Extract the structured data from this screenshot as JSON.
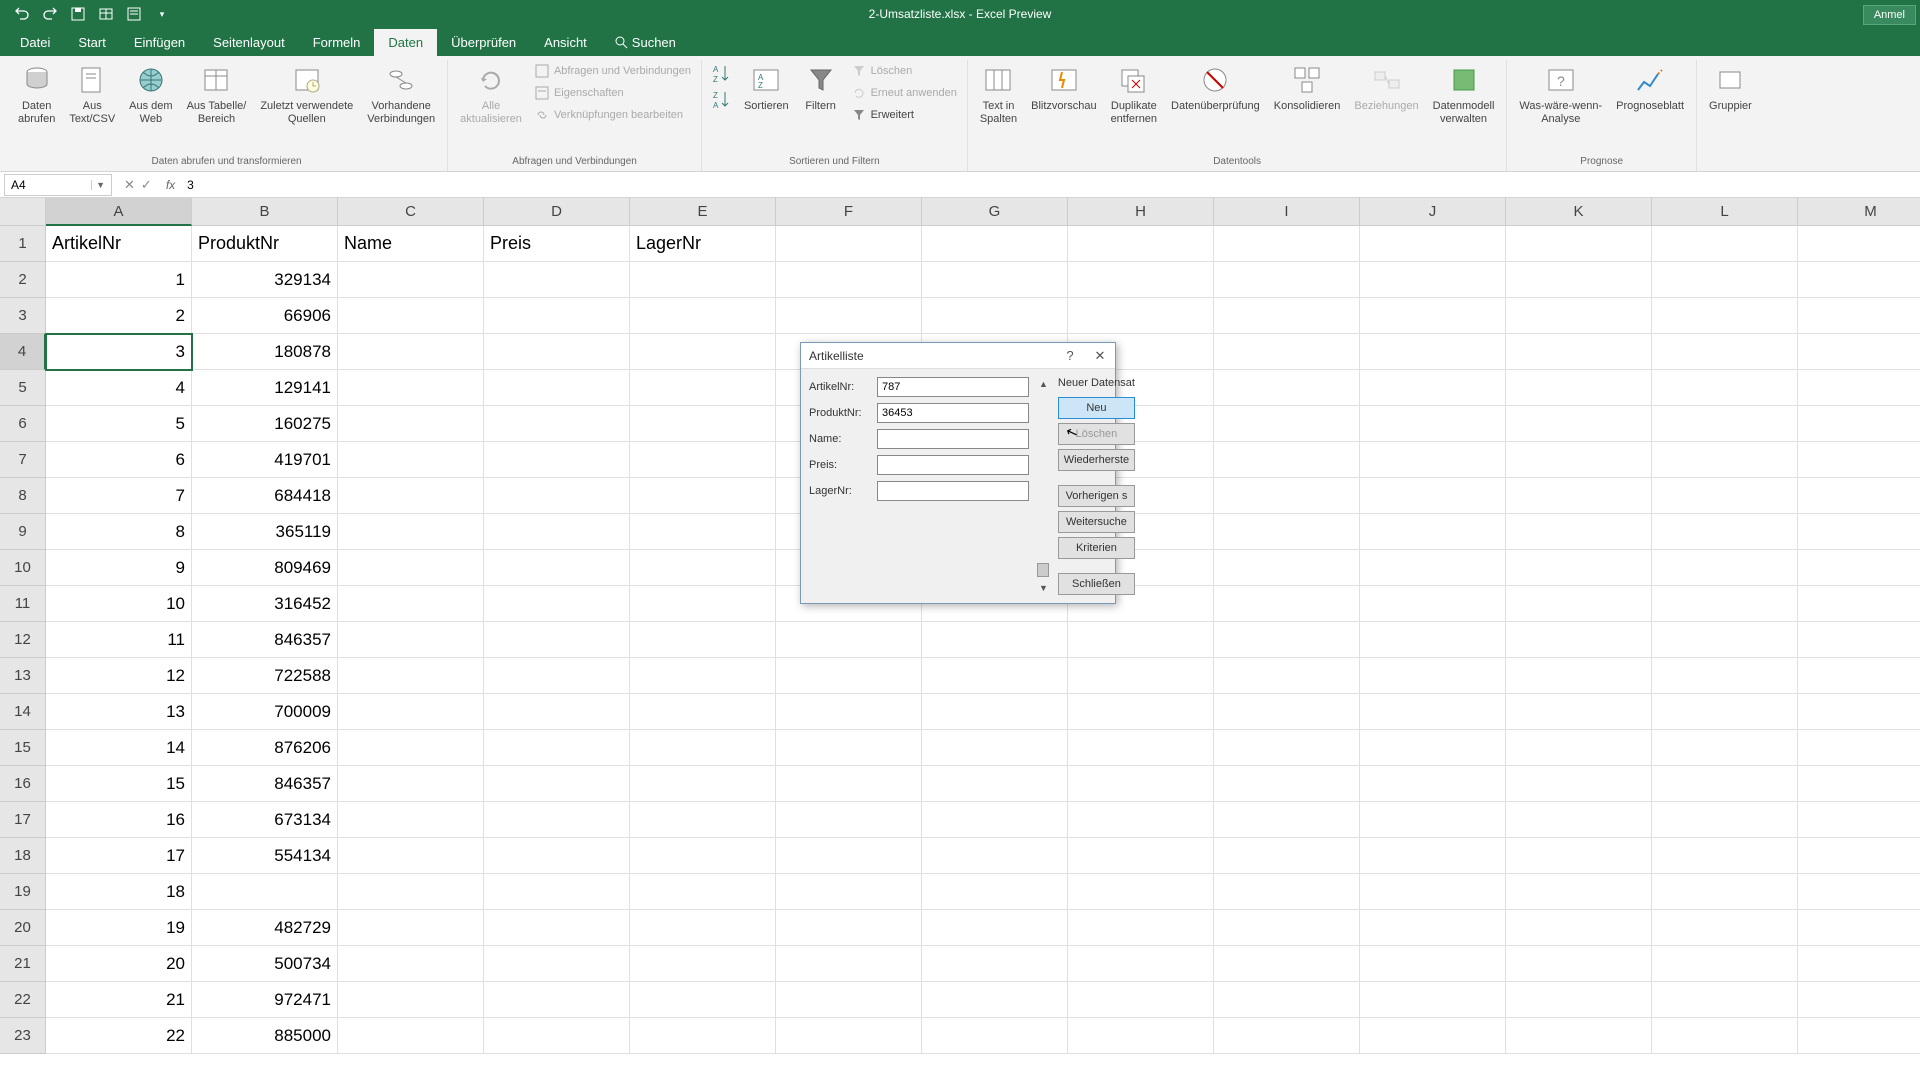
{
  "app": {
    "title": "2-Umsatzliste.xlsx - Excel Preview",
    "signin": "Anmel"
  },
  "tabs": {
    "datei": "Datei",
    "start": "Start",
    "einfuegen": "Einfügen",
    "seitenlayout": "Seitenlayout",
    "formeln": "Formeln",
    "daten": "Daten",
    "ueberpruefen": "Überprüfen",
    "ansicht": "Ansicht",
    "suchen": "Suchen"
  },
  "ribbon": {
    "daten_abrufen": "Daten\nabrufen",
    "aus_text": "Aus\nText/CSV",
    "aus_web": "Aus dem\nWeb",
    "aus_tabelle": "Aus Tabelle/\nBereich",
    "zuletzt": "Zuletzt verwendete\nQuellen",
    "vorhandene": "Vorhandene\nVerbindungen",
    "group_abrufen": "Daten abrufen und transformieren",
    "alle_akt": "Alle\naktualisieren",
    "abfragen": "Abfragen und Verbindungen",
    "eigenschaften": "Eigenschaften",
    "verknuepfungen": "Verknüpfungen bearbeiten",
    "group_abfragen": "Abfragen und Verbindungen",
    "sortieren": "Sortieren",
    "filtern": "Filtern",
    "loeschen": "Löschen",
    "erneut": "Erneut anwenden",
    "erweitert": "Erweitert",
    "group_sortieren": "Sortieren und Filtern",
    "text_spalten": "Text in\nSpalten",
    "blitzvorschau": "Blitzvorschau",
    "duplikate": "Duplikate\nentfernen",
    "datenpruefung": "Datenüberprüfung",
    "konsolidieren": "Konsolidieren",
    "beziehungen": "Beziehungen",
    "datenmodell": "Datenmodell\nverwalten",
    "group_datentools": "Datentools",
    "was_waere": "Was-wäre-wenn-\nAnalyse",
    "prognoseblatt": "Prognoseblatt",
    "group_prognose": "Prognose",
    "gruppier": "Gruppier"
  },
  "formula": {
    "name_box": "A4",
    "value": "3"
  },
  "columns": [
    "A",
    "B",
    "C",
    "D",
    "E",
    "F",
    "G",
    "H",
    "I",
    "J",
    "K",
    "L",
    "M"
  ],
  "headers": {
    "A": "ArtikelNr",
    "B": "ProduktNr",
    "C": "Name",
    "D": "Preis",
    "E": "LagerNr"
  },
  "rows": [
    {
      "n": 1,
      "a": "1",
      "b": "329134"
    },
    {
      "n": 2,
      "a": "2",
      "b": "66906"
    },
    {
      "n": 3,
      "a": "3",
      "b": "180878"
    },
    {
      "n": 4,
      "a": "4",
      "b": "129141"
    },
    {
      "n": 5,
      "a": "5",
      "b": "160275"
    },
    {
      "n": 6,
      "a": "6",
      "b": "419701"
    },
    {
      "n": 7,
      "a": "7",
      "b": "684418"
    },
    {
      "n": 8,
      "a": "8",
      "b": "365119"
    },
    {
      "n": 9,
      "a": "9",
      "b": "809469"
    },
    {
      "n": 10,
      "a": "10",
      "b": "316452"
    },
    {
      "n": 11,
      "a": "11",
      "b": "846357"
    },
    {
      "n": 12,
      "a": "12",
      "b": "722588"
    },
    {
      "n": 13,
      "a": "13",
      "b": "700009"
    },
    {
      "n": 14,
      "a": "14",
      "b": "876206"
    },
    {
      "n": 15,
      "a": "15",
      "b": "846357"
    },
    {
      "n": 16,
      "a": "16",
      "b": "673134"
    },
    {
      "n": 17,
      "a": "17",
      "b": "554134"
    },
    {
      "n": 18,
      "a": "18",
      "b": ""
    },
    {
      "n": 19,
      "a": "19",
      "b": "482729"
    },
    {
      "n": 20,
      "a": "20",
      "b": "500734"
    },
    {
      "n": 21,
      "a": "21",
      "b": "972471"
    },
    {
      "n": 22,
      "a": "22",
      "b": "885000"
    }
  ],
  "dialog": {
    "title": "Artikelliste",
    "status": "Neuer Datensat",
    "fields": {
      "artikelnr_label": "ArtikelNr:",
      "artikelnr_value": "787",
      "produktnr_label": "ProduktNr:",
      "produktnr_value": "36453",
      "name_label": "Name:",
      "name_value": "",
      "preis_label": "Preis:",
      "preis_value": "",
      "lagernr_label": "LagerNr:",
      "lagernr_value": ""
    },
    "buttons": {
      "neu": "Neu",
      "loeschen": "Löschen",
      "wiederherste": "Wiederherste",
      "vorherigen": "Vorherigen s",
      "weitersuche": "Weitersuche",
      "kriterien": "Kriterien",
      "schliessen": "Schließen"
    }
  }
}
